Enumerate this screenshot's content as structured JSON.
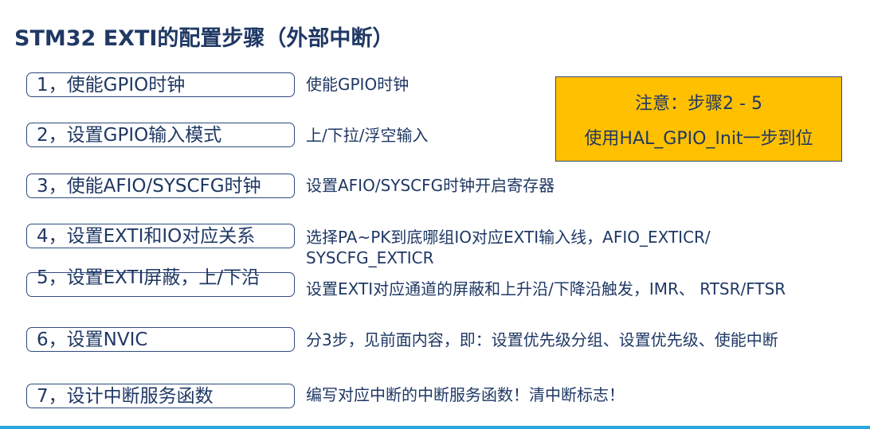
{
  "title": "STM32 EXTI的配置步骤（外部中断）",
  "steps": [
    {
      "label": "1，使能GPIO时钟",
      "desc": "使能GPIO时钟"
    },
    {
      "label": "2，设置GPIO输入模式",
      "desc": "上/下拉/浮空输入"
    },
    {
      "label": "3，使能AFIO/SYSCFG时钟",
      "desc": "设置AFIO/SYSCFG时钟开启寄存器"
    },
    {
      "label": "4，设置EXTI和IO对应关系",
      "desc": "选择PA~PK到底哪组IO对应EXTI输入线，AFIO_EXTICR/ SYSCFG_EXTICR"
    },
    {
      "label": "5，设置EXTI屏蔽，上/下沿",
      "desc": "设置EXTI对应通道的屏蔽和上升沿/下降沿触发，IMR、 RTSR/FTSR"
    },
    {
      "label": "6，设置NVIC",
      "desc": "分3步，见前面内容，即：设置优先级分组、设置优先级、使能中断"
    },
    {
      "label": "7，设计中断服务函数",
      "desc": "编写对应中断的中断服务函数！清中断标志！"
    }
  ],
  "note": {
    "line1": "注意：步骤2 - 5",
    "line2": "使用HAL_GPIO_Init一步到位"
  },
  "colors": {
    "text": "#1f3864",
    "note_background": "#ffc000",
    "bottom_line": "#2aa7e0"
  }
}
